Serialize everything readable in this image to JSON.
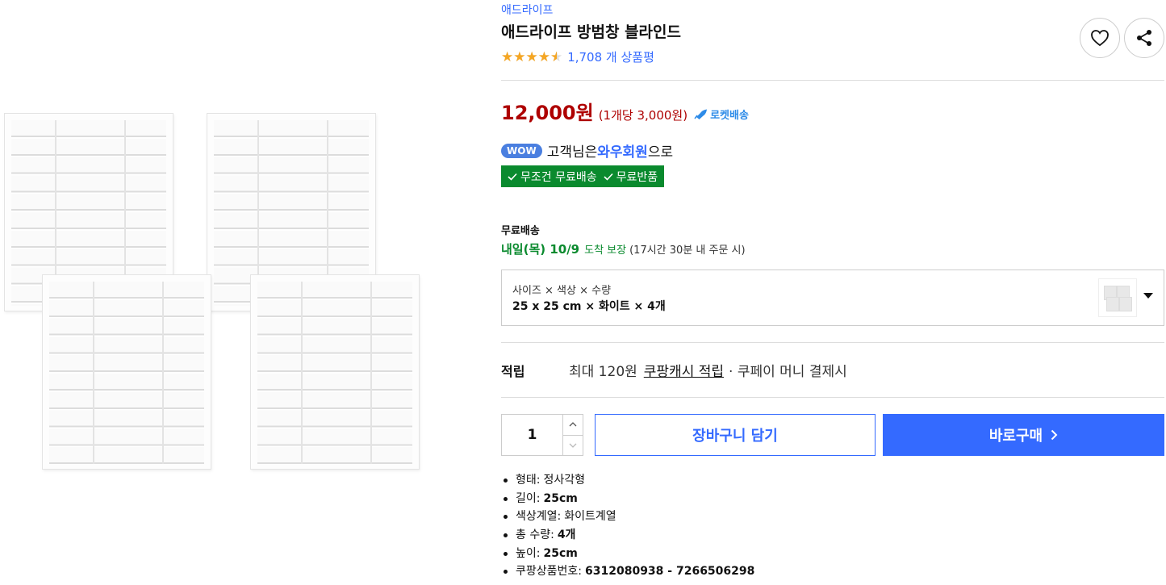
{
  "product": {
    "brand": "애드라이프",
    "title": "애드라이프 방범창 블라인드",
    "stars": "★★★★★",
    "rating_fraction": 0.9,
    "review_count": "1,708 개 상품평"
  },
  "price": {
    "amount": "12,000원",
    "unit_price": "(1개당 3,000원)",
    "rocket_label": "로켓배송"
  },
  "wow": {
    "badge": "WOW",
    "prefix": "고객님은 ",
    "member": "와우회원",
    "suffix": "으로",
    "benefit_1": "무조건 무료배송",
    "benefit_2": "무료반품"
  },
  "shipping": {
    "label": "무료배송",
    "arrival": "내일(목) 10/9",
    "guarantee": "도착 보장",
    "cutoff": "(17시간 30분 내 주문 시)"
  },
  "option": {
    "label": "사이즈 × 색상 × 수량",
    "value": "25 x 25 cm × 화이트 × 4개"
  },
  "points": {
    "label": "적립",
    "max": "최대 120원",
    "cash": "쿠팡캐시 적립",
    "pay": "· 쿠페이 머니 결제시"
  },
  "purchase": {
    "quantity": "1",
    "cart_label": "장바구니 담기",
    "buy_label": "바로구매"
  },
  "attributes": [
    {
      "key": "형태:",
      "value": "정사각형",
      "bold": false
    },
    {
      "key": "길이:",
      "value": "25cm",
      "bold": true
    },
    {
      "key": "색상계열:",
      "value": "화이트계열",
      "bold": false
    },
    {
      "key": "총 수량:",
      "value": "4개",
      "bold": true
    },
    {
      "key": "높이:",
      "value": "25cm",
      "bold": true
    },
    {
      "key": "쿠팡상품번호:",
      "value": "6312080938 - 7266506298",
      "bold": true
    }
  ],
  "colors": {
    "accent_blue": "#346aff",
    "price_red": "#ae0000",
    "green": "#0a8a2e",
    "star": "#f5a623"
  }
}
